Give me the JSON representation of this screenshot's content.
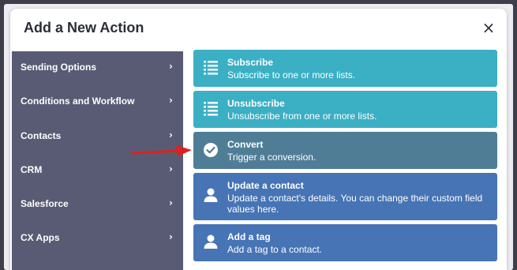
{
  "modal": {
    "title": "Add a New Action",
    "close_label": "×"
  },
  "sidebar": {
    "items": [
      {
        "label": "Sending Options",
        "chevron": "›"
      },
      {
        "label": "Conditions and Workflow",
        "chevron": "›"
      },
      {
        "label": "Contacts",
        "chevron": "›"
      },
      {
        "label": "CRM",
        "chevron": "›"
      },
      {
        "label": "Salesforce",
        "chevron": "›"
      },
      {
        "label": "CX Apps",
        "chevron": "›"
      }
    ]
  },
  "actions": [
    {
      "name": "Subscribe",
      "description": "Subscribe to one or more lists.",
      "icon": "list-icon",
      "color": "#3bafc4"
    },
    {
      "name": "Unsubscribe",
      "description": "Unsubscribe from one or more lists.",
      "icon": "list-icon",
      "color": "#3bafc4"
    },
    {
      "name": "Convert",
      "description": "Trigger a conversion.",
      "icon": "checkmark-circle-icon",
      "color": "#4f7d96"
    },
    {
      "name": "Update a contact",
      "description": "Update a contact's details. You can change their custom field values here.",
      "icon": "user-icon",
      "color": "#4674b5"
    },
    {
      "name": "Add a tag",
      "description": "Add a tag to a contact.",
      "icon": "user-icon",
      "color": "#4674b5"
    }
  ],
  "colors": {
    "sidebar_bg": "#585b73",
    "annotation_arrow": "#e0201f"
  }
}
